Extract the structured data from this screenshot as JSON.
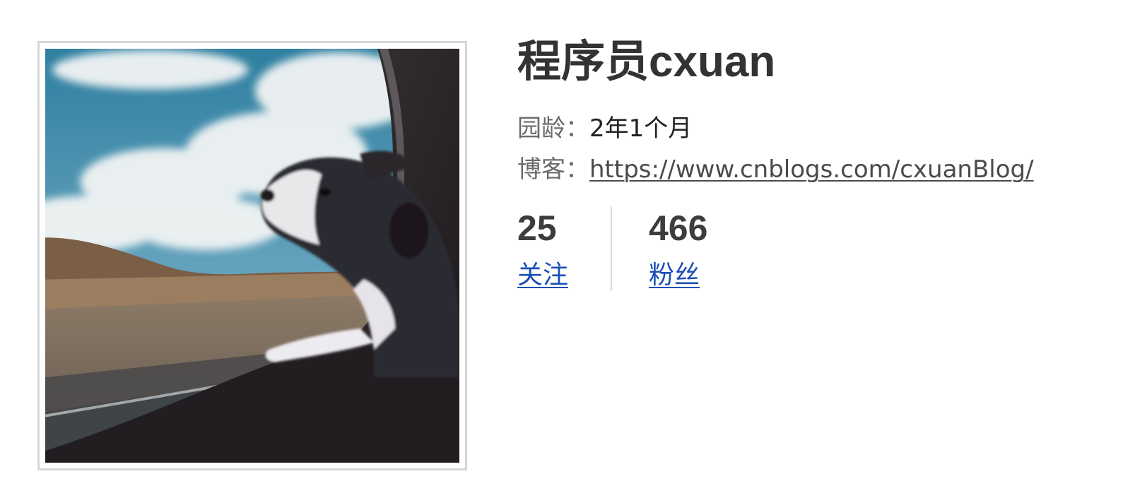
{
  "profile": {
    "name": "程序员cxuan",
    "age_label": "园龄：",
    "age_value": "2年1个月",
    "blog_label": "博客：",
    "blog_url": "https://www.cnblogs.com/cxuanBlog/"
  },
  "stats": {
    "following": {
      "count": "25",
      "label": "关注"
    },
    "followers": {
      "count": "466",
      "label": "粉丝"
    }
  },
  "avatar": {
    "icon": "dog-in-car-photo"
  },
  "colors": {
    "link": "#1a4eb6",
    "name_text": "#333333",
    "label_text": "#6b6b6b",
    "frame_border": "#d6d6d6"
  }
}
